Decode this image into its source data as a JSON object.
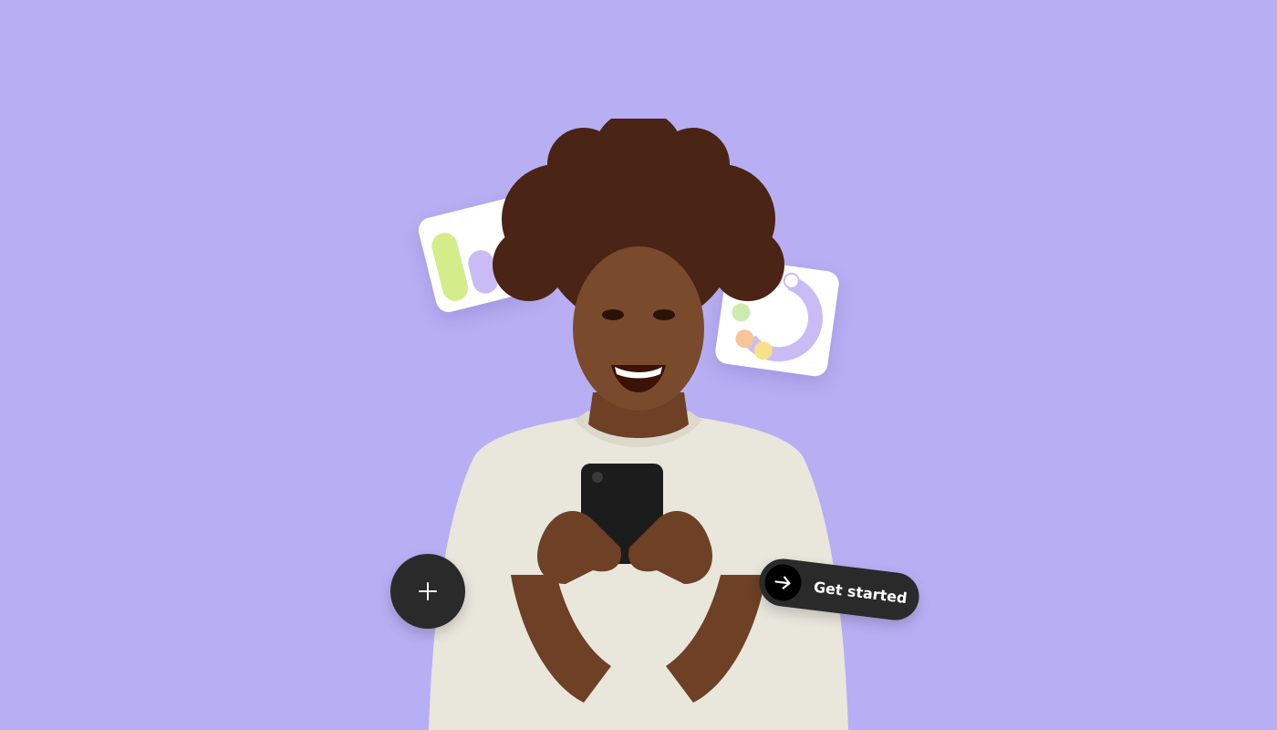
{
  "page": {
    "background_color": "#b8aef3"
  },
  "cards": {
    "bar_card": {
      "icon": "bar-chart-card",
      "bar_colors": [
        "#d4ec8a",
        "#c9bcf5",
        "#c9bcf5"
      ]
    },
    "donut_card": {
      "icon": "donut-chart-card",
      "segment_colors": [
        "#c9bcf5",
        "#f6c59a",
        "#f7e08a",
        "#cdebb0",
        "#e6c7f2"
      ]
    }
  },
  "buttons": {
    "add": {
      "icon": "plus-icon"
    },
    "get_started": {
      "label": "Get started",
      "icon": "arrow-right-icon"
    }
  },
  "colors": {
    "button_bg": "#2a2a2a",
    "sweater": "#e9e6dc",
    "skin": "#7a4a2c",
    "hair": "#4a2414"
  }
}
